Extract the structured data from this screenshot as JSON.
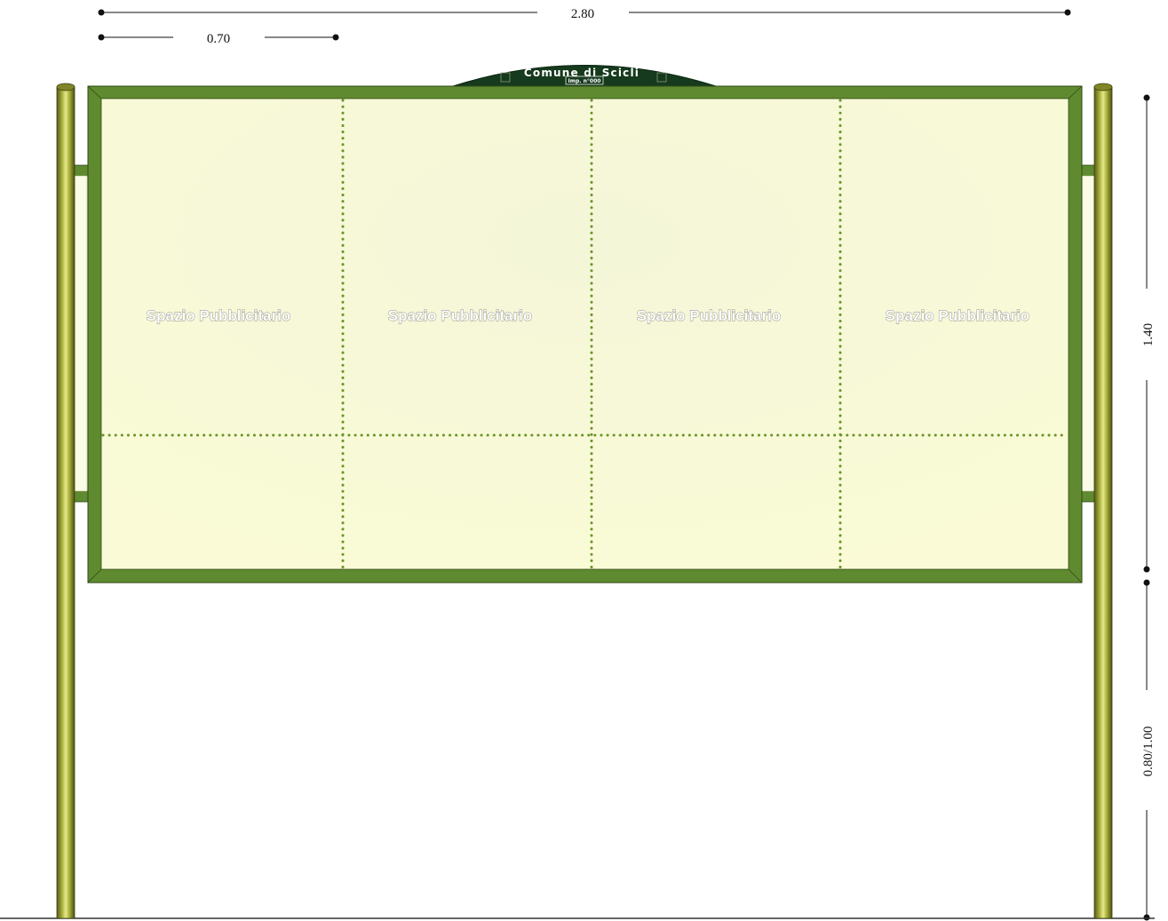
{
  "dimensions": {
    "total_width": "2.80",
    "panel_width": "0.70",
    "board_height": "1.40",
    "ground_clearance": "0.80/1.00"
  },
  "sign": {
    "title": "Comune di Scicli",
    "plate": "Imp. n°000"
  },
  "panels": [
    {
      "label": "Spazio Pubblicitario"
    },
    {
      "label": "Spazio Pubblicitario"
    },
    {
      "label": "Spazio Pubblicitario"
    },
    {
      "label": "Spazio Pubblicitario"
    }
  ],
  "colors": {
    "frame": "#5f8a30",
    "frame_dark": "#3e5e1c",
    "board": "#f8f9d6",
    "post": "#a9b03a",
    "divider": "#6b9427",
    "sign_arch": "#163a1d"
  }
}
